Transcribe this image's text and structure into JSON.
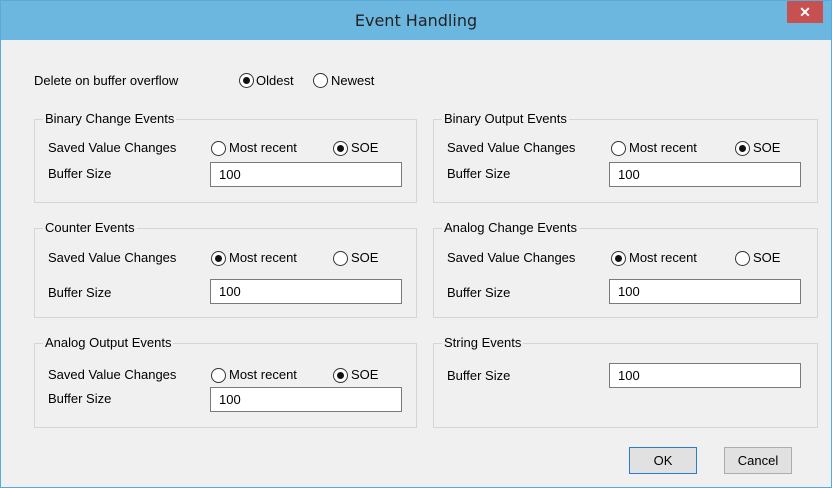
{
  "window": {
    "title": "Event Handling",
    "close_glyph": "✕"
  },
  "overflow": {
    "label": "Delete on buffer overflow",
    "options": [
      {
        "label": "Oldest",
        "selected": true
      },
      {
        "label": "Newest",
        "selected": false
      }
    ]
  },
  "common": {
    "saved_label": "Saved Value Changes",
    "buffer_label": "Buffer Size",
    "opt_recent": "Most recent",
    "opt_soe": "SOE"
  },
  "groups": {
    "binary_change": {
      "title": "Binary Change Events",
      "selection": "SOE",
      "buffer_size": "100"
    },
    "binary_output": {
      "title": "Binary Output Events",
      "selection": "SOE",
      "buffer_size": "100"
    },
    "counter": {
      "title": "Counter Events",
      "selection": "Most recent",
      "buffer_size": "100"
    },
    "analog_change": {
      "title": "Analog Change Events",
      "selection": "Most recent",
      "buffer_size": "100"
    },
    "analog_output": {
      "title": "Analog Output Events",
      "selection": "SOE",
      "buffer_size": "100"
    },
    "string": {
      "title": "String Events",
      "buffer_size": "100"
    }
  },
  "buttons": {
    "ok": "OK",
    "cancel": "Cancel"
  }
}
